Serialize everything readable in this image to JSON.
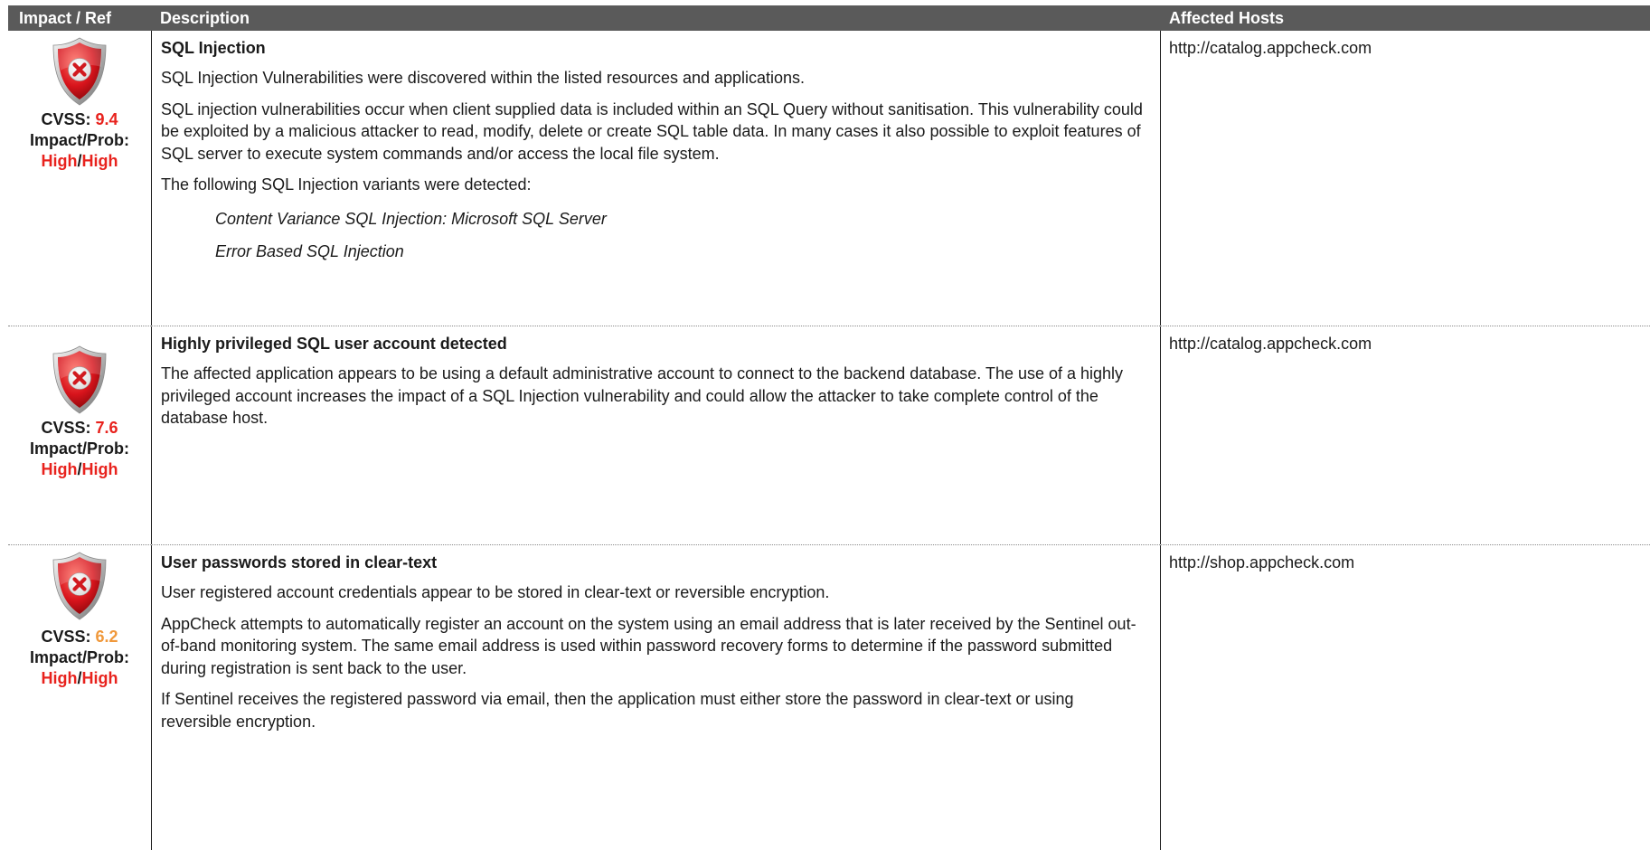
{
  "header": {
    "col_impact": "Impact / Ref",
    "col_description": "Description",
    "col_hosts": "Affected Hosts"
  },
  "findings": [
    {
      "cvss_label": "CVSS:",
      "cvss_score": "9.4",
      "impact_label": "Impact/Prob:",
      "impact": "High",
      "separator": "/",
      "probability": "High",
      "title": "SQL Injection",
      "paragraphs": [
        "SQL Injection Vulnerabilities were discovered within the listed resources and applications.",
        "SQL injection vulnerabilities occur when client supplied data is included within an SQL Query without sanitisation. This vulnerability could be exploited by a malicious attacker to read, modify, delete or create SQL table data. In many cases it also possible to exploit features of SQL server to execute system commands and/or access the local file system.",
        "The following SQL Injection variants were detected:"
      ],
      "variants": [
        "Content Variance SQL Injection: Microsoft SQL Server",
        "Error Based SQL Injection"
      ],
      "host": "http://catalog.appcheck.com"
    },
    {
      "cvss_label": "CVSS:",
      "cvss_score": "7.6",
      "impact_label": "Impact/Prob:",
      "impact": "High",
      "separator": "/",
      "probability": "High",
      "title": "Highly privileged SQL user account detected",
      "paragraphs": [
        "The affected application appears to be using a default administrative account to connect to the backend database. The use of a highly privileged account increases the impact of a SQL Injection vulnerability and could allow the attacker to take complete control of the database host."
      ],
      "host": "http://catalog.appcheck.com"
    },
    {
      "cvss_label": "CVSS:",
      "cvss_score": "6.2",
      "impact_label": "Impact/Prob:",
      "impact": "High",
      "separator": "/",
      "probability": "High",
      "title": "User passwords stored in clear-text",
      "paragraphs": [
        "User registered account credentials appear to be stored in clear-text or reversible encryption.",
        "AppCheck attempts to automatically register an account on the system using an email address that is later received by the Sentinel out-of-band monitoring system. The same email address is used within password recovery forms to determine if the password submitted during registration is sent back to the user.",
        "If Sentinel receives the registered password via email, then the application must either store the password in clear-text or using reversible encryption."
      ],
      "host": "http://shop.appcheck.com"
    }
  ],
  "colors": {
    "header_bg": "#5a5a5a",
    "high": "#e8221d",
    "medium_score": "#f0983a"
  },
  "icons": {
    "severity": "shield-error-icon"
  }
}
